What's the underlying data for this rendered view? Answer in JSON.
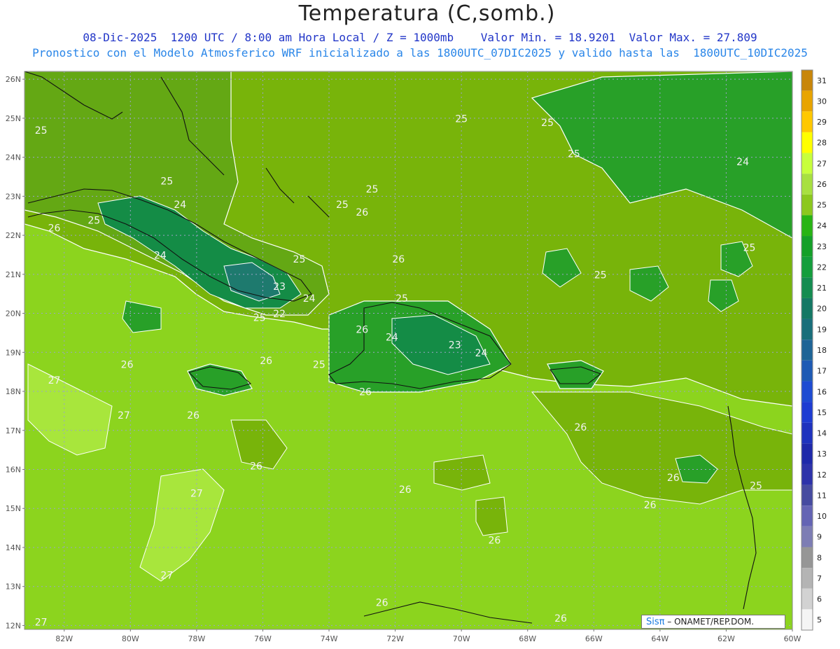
{
  "title": "Temperatura (C,somb.)",
  "subtitle_line1": "08-Dic-2025  1200 UTC / 8:00 am Hora Local / Z = 1000mb    Valor Min. = 18.9201  Valor Max. = 27.809",
  "subtitle_line2": "Pronostico con el Modelo Atmosferico WRF inicializado a las 1800UTC_07DIC2025 y valido hasta las  1800UTC_10DIC2025",
  "credit": {
    "logo": "Sisπ",
    "text": "– ONAMET/REP.DOM."
  },
  "map": {
    "lon_range": [
      -83.2,
      -60
    ],
    "lat_range": [
      11.9,
      26.2
    ],
    "lat_labels": [
      "26N",
      "25N",
      "24N",
      "23N",
      "22N",
      "21N",
      "20N",
      "19N",
      "18N",
      "17N",
      "16N",
      "15N",
      "14N",
      "13N",
      "12N"
    ],
    "lat_values": [
      26,
      25,
      24,
      23,
      22,
      21,
      20,
      19,
      18,
      17,
      16,
      15,
      14,
      13,
      12
    ],
    "lon_labels": [
      "82W",
      "80W",
      "78W",
      "76W",
      "74W",
      "72W",
      "70W",
      "68W",
      "66W",
      "64W",
      "62W",
      "60W"
    ],
    "lon_values": [
      -82,
      -80,
      -78,
      -76,
      -74,
      -72,
      -70,
      -68,
      -66,
      -64,
      -62,
      -60
    ],
    "grid": true,
    "contour_labels": [
      {
        "text": "25",
        "lon": -82.7,
        "lat": 24.6
      },
      {
        "text": "25",
        "lon": -78.9,
        "lat": 23.3
      },
      {
        "text": "24",
        "lon": -78.5,
        "lat": 22.7
      },
      {
        "text": "25",
        "lon": -81.1,
        "lat": 22.3
      },
      {
        "text": "26",
        "lon": -82.3,
        "lat": 22.1
      },
      {
        "text": "24",
        "lon": -79.1,
        "lat": 21.4
      },
      {
        "text": "25",
        "lon": -74.9,
        "lat": 21.3
      },
      {
        "text": "23",
        "lon": -75.5,
        "lat": 20.6
      },
      {
        "text": "24",
        "lon": -74.6,
        "lat": 20.3
      },
      {
        "text": "22",
        "lon": -75.5,
        "lat": 19.9
      },
      {
        "text": "25",
        "lon": -76.1,
        "lat": 19.8
      },
      {
        "text": "26",
        "lon": -73.0,
        "lat": 22.5
      },
      {
        "text": "25",
        "lon": -73.6,
        "lat": 22.7
      },
      {
        "text": "26",
        "lon": -71.9,
        "lat": 21.3
      },
      {
        "text": "25",
        "lon": -72.7,
        "lat": 23.1
      },
      {
        "text": "25",
        "lon": -71.8,
        "lat": 20.3
      },
      {
        "text": "26",
        "lon": -73.0,
        "lat": 19.5
      },
      {
        "text": "24",
        "lon": -72.1,
        "lat": 19.3
      },
      {
        "text": "23",
        "lon": -70.2,
        "lat": 19.1
      },
      {
        "text": "24",
        "lon": -69.4,
        "lat": 18.9
      },
      {
        "text": "25",
        "lon": -74.3,
        "lat": 18.6
      },
      {
        "text": "26",
        "lon": -72.9,
        "lat": 17.9
      },
      {
        "text": "26",
        "lon": -80.1,
        "lat": 18.6
      },
      {
        "text": "26",
        "lon": -75.9,
        "lat": 18.7
      },
      {
        "text": "27",
        "lon": -82.3,
        "lat": 18.2
      },
      {
        "text": "27",
        "lon": -80.2,
        "lat": 17.3
      },
      {
        "text": "26",
        "lon": -78.1,
        "lat": 17.3
      },
      {
        "text": "26",
        "lon": -66.4,
        "lat": 17.0
      },
      {
        "text": "26",
        "lon": -76.2,
        "lat": 16.0
      },
      {
        "text": "27",
        "lon": -78.0,
        "lat": 15.3
      },
      {
        "text": "26",
        "lon": -71.7,
        "lat": 15.4
      },
      {
        "text": "26",
        "lon": -69.0,
        "lat": 14.1
      },
      {
        "text": "26",
        "lon": -64.3,
        "lat": 15.0
      },
      {
        "text": "26",
        "lon": -63.6,
        "lat": 15.7
      },
      {
        "text": "25",
        "lon": -61.1,
        "lat": 15.5
      },
      {
        "text": "27",
        "lon": -78.9,
        "lat": 13.2
      },
      {
        "text": "26",
        "lon": -72.4,
        "lat": 12.5
      },
      {
        "text": "26",
        "lon": -67.0,
        "lat": 12.1
      },
      {
        "text": "27",
        "lon": -82.7,
        "lat": 12.0
      },
      {
        "text": "25",
        "lon": -70.0,
        "lat": 24.9
      },
      {
        "text": "25",
        "lon": -67.4,
        "lat": 24.8
      },
      {
        "text": "25",
        "lon": -66.6,
        "lat": 24.0
      },
      {
        "text": "24",
        "lon": -61.5,
        "lat": 23.8
      },
      {
        "text": "25",
        "lon": -65.8,
        "lat": 20.9
      },
      {
        "text": "25",
        "lon": -61.3,
        "lat": 21.6
      }
    ]
  },
  "colorbar": {
    "labels": [
      "31",
      "30",
      "29",
      "28",
      "27",
      "26",
      "25",
      "24",
      "23",
      "22",
      "21",
      "20",
      "19",
      "18",
      "17",
      "16",
      "15",
      "14",
      "13",
      "12",
      "11",
      "10",
      "9",
      "8",
      "7",
      "6",
      "5"
    ],
    "colors": [
      "#c8860a",
      "#e8a400",
      "#ffc800",
      "#ffff00",
      "#c8ff3c",
      "#a8e040",
      "#8cc81e",
      "#28b414",
      "#14a028",
      "#149e3c",
      "#148c50",
      "#147864",
      "#186e7a",
      "#1e6496",
      "#1e5ab4",
      "#1e4bd2",
      "#1e3cd2",
      "#1e32be",
      "#1e28aa",
      "#2d32aa",
      "#464ba0",
      "#6464b4",
      "#7d7db4",
      "#969696",
      "#b4b4b4",
      "#d2d2d2",
      "#f4f4f4"
    ]
  },
  "field_colors": {
    "t27": "#a8e63c",
    "t26": "#8cd41e",
    "t25": "#78b40a",
    "t24": "#64a814",
    "t23": "#28a028",
    "t22": "#148c46",
    "t21": "#1e7a6e",
    "t20": "#2a7a78"
  }
}
